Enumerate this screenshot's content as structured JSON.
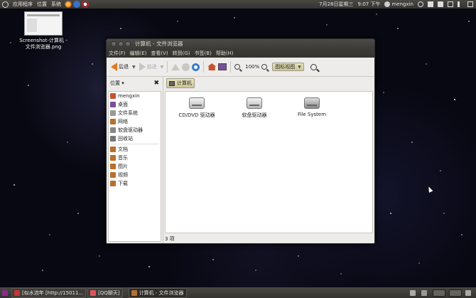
{
  "top_panel": {
    "menus": [
      "应用程序",
      "位置",
      "系统"
    ],
    "clock": "7月28日星期三",
    "time": "9:07 下午",
    "user": "mengxin"
  },
  "desktop": {
    "icon_label_line1": "Screenshot-计算机 -",
    "icon_label_line2": "文件浏览器.png"
  },
  "window": {
    "title": "计算机 - 文件浏览器",
    "menus": [
      "文件(F)",
      "编辑(E)",
      "查看(V)",
      "转到(G)",
      "书签(B)",
      "帮助(H)"
    ],
    "toolbar": {
      "back": "后退",
      "forward": "前进",
      "zoom": "100%",
      "view": "图标视图"
    },
    "sidebar": {
      "header": "位置",
      "items": [
        "mengxin",
        "桌面",
        "文件系统",
        "网络",
        "软盘驱动器",
        "回收站"
      ],
      "bookmarks": [
        "文档",
        "音乐",
        "图片",
        "视频",
        "下载"
      ]
    },
    "location": "计算机",
    "files": [
      "CD/DVD 驱动器",
      "软盘驱动器",
      "File System"
    ],
    "status": "3 项"
  },
  "taskbar": {
    "tasks": [
      "[似水流年 [http://15011...",
      "[QQ聊天]",
      "计算机 - 文件浏览器"
    ]
  },
  "colors": {
    "panel": "#3c3b37",
    "accent_orange": "#e07b20",
    "selection": "#cfc79a"
  }
}
